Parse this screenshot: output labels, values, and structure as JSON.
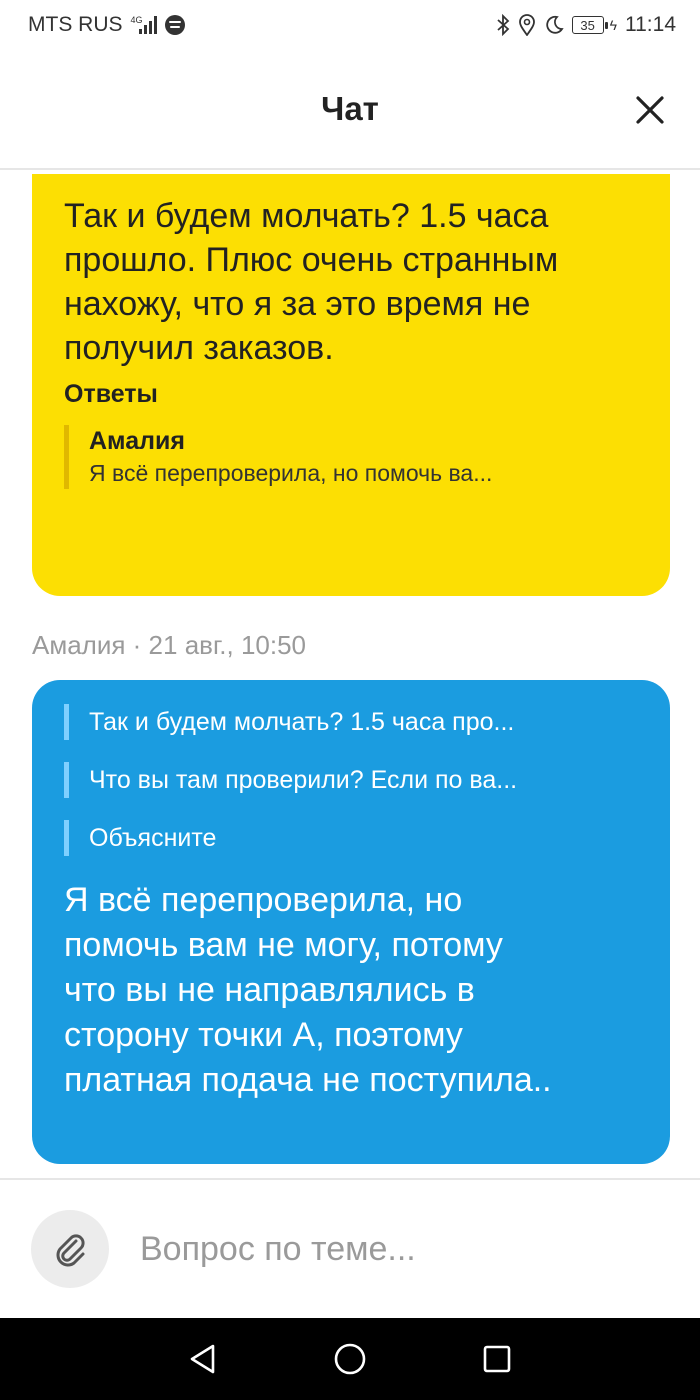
{
  "status_bar": {
    "carrier": "MTS RUS",
    "network_label": "4G",
    "battery": "35",
    "time": "11:14"
  },
  "header": {
    "title": "Чат"
  },
  "messages": {
    "outgoing": {
      "text": "Так и будем молчать? 1.5 часа прошло. Плюс очень странным нахожу, что я за это время не получил заказов.",
      "replies_label": "Ответы",
      "reply_author": "Амалия",
      "reply_text": "Я всё перепроверила, но помочь ва..."
    },
    "incoming_meta": "Амалия · 21 авг., 10:50",
    "incoming": {
      "quotes": [
        "Так и будем молчать? 1.5 часа про...",
        "Что вы там проверили? Если по ва...",
        "Объясните"
      ],
      "text": "Я всё перепроверила, но помочь вам не могу, потому что  вы не направлялись в сторону точки А, поэтому платная подача не поступила.."
    }
  },
  "input": {
    "placeholder": "Вопрос по теме...",
    "value": ""
  },
  "colors": {
    "outgoing_bubble": "#fcdf03",
    "incoming_bubble": "#1b9ce0",
    "nav_bar": "#000000"
  },
  "icons": {
    "close": "close-icon",
    "attach": "paperclip-icon",
    "nav_back": "back-triangle-icon",
    "nav_home": "home-circle-icon",
    "nav_recents": "recents-square-icon"
  }
}
